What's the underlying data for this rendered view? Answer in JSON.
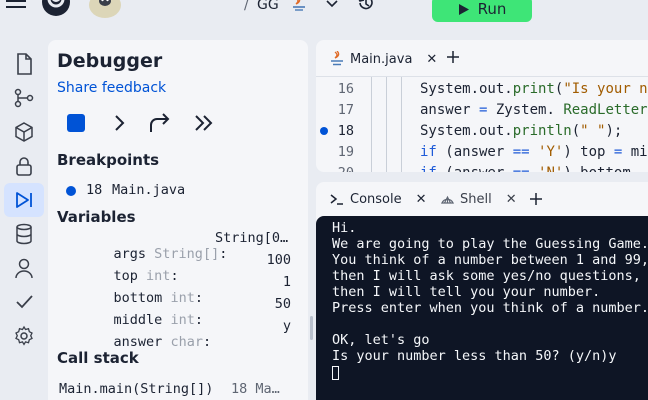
{
  "topbar": {
    "breadcrumb_sep": "/",
    "repl_name": "GG",
    "run_label": "Run"
  },
  "rail": {
    "items": [
      "files-icon",
      "git-icon",
      "packages-icon",
      "secrets-icon",
      "debugger-icon",
      "database-icon",
      "user-icon",
      "check-icon",
      "settings-icon"
    ]
  },
  "debugger": {
    "title": "Debugger",
    "feedback": "Share feedback",
    "breakpoints_title": "Breakpoints",
    "breakpoint": {
      "line": "18",
      "file": "Main.java"
    },
    "variables_title": "Variables",
    "variables": [
      {
        "name": "args",
        "type": "String[]",
        "value": "String[0…"
      },
      {
        "name": "top",
        "type": "int",
        "value": "100"
      },
      {
        "name": "bottom",
        "type": "int",
        "value": "1"
      },
      {
        "name": "middle",
        "type": "int",
        "value": "50"
      },
      {
        "name": "answer",
        "type": "char",
        "value": "y"
      }
    ],
    "callstack_title": "Call stack",
    "callstack_frame": "Main.main(String[])",
    "callstack_loc": "18 Ma…",
    "colors": {
      "accent": "#0053d6"
    }
  },
  "editor": {
    "tab_label": "Main.java",
    "line_numbers": [
      "16",
      "17",
      "18",
      "19",
      "20"
    ]
  },
  "console": {
    "tab_console": "Console",
    "tab_shell": "Shell",
    "lines": [
      "Hi.",
      "We are going to play the Guessing Game.",
      "You think of a number between 1 and 99,",
      "then I will ask some yes/no questions,",
      "then I will tell you your number.",
      "Press enter when you think of a number.",
      "",
      "OK, let's go",
      "Is your number less than 50? (y/n)y"
    ]
  }
}
